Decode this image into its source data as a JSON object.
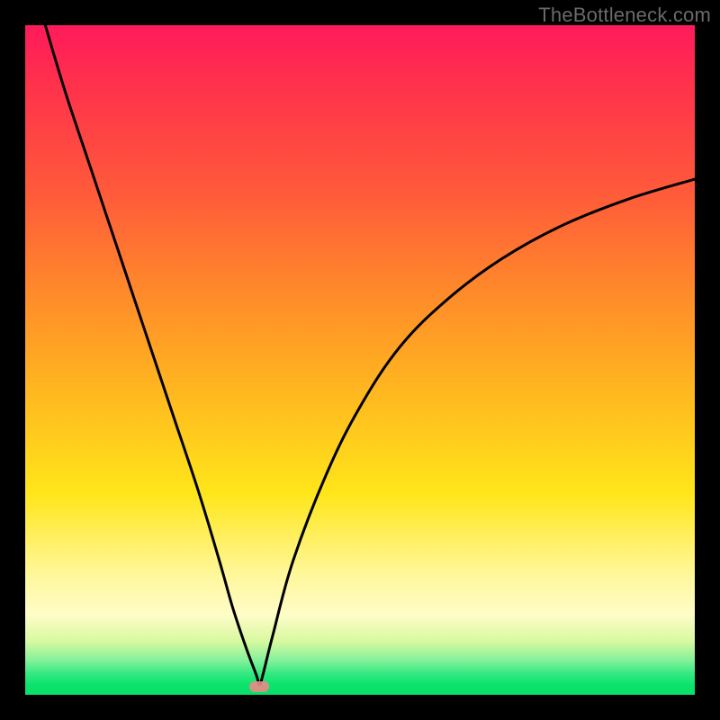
{
  "watermark": "TheBottleneck.com",
  "colors": {
    "frame": "#000000",
    "curve": "#000000",
    "marker": "#e98b87"
  },
  "chart_data": {
    "type": "line",
    "title": "",
    "xlabel": "",
    "ylabel": "",
    "xlim": [
      0,
      100
    ],
    "ylim": [
      0,
      100
    ],
    "grid": false,
    "legend": false,
    "series": [
      {
        "name": "bottleneck-curve",
        "x": [
          3,
          6,
          10,
          14,
          18,
          22,
          26,
          29,
          31,
          33,
          34.5,
          35,
          35.5,
          37,
          40,
          45,
          50,
          56,
          63,
          71,
          80,
          90,
          100
        ],
        "y": [
          100,
          90,
          78,
          66,
          54,
          42,
          30,
          20,
          13,
          7,
          3,
          1.5,
          3,
          9,
          20,
          33,
          43,
          52,
          59,
          65,
          70,
          74,
          77
        ]
      }
    ],
    "annotations": [
      {
        "name": "min-marker",
        "x": 35,
        "y": 1.2
      }
    ],
    "background_gradient": {
      "stops": [
        {
          "pos": 0.0,
          "color": "#ff1a5b"
        },
        {
          "pos": 0.25,
          "color": "#ff5a3a"
        },
        {
          "pos": 0.55,
          "color": "#ffb81f"
        },
        {
          "pos": 0.82,
          "color": "#fff79a"
        },
        {
          "pos": 0.95,
          "color": "#7ef19a"
        },
        {
          "pos": 1.0,
          "color": "#08e06b"
        }
      ]
    }
  }
}
